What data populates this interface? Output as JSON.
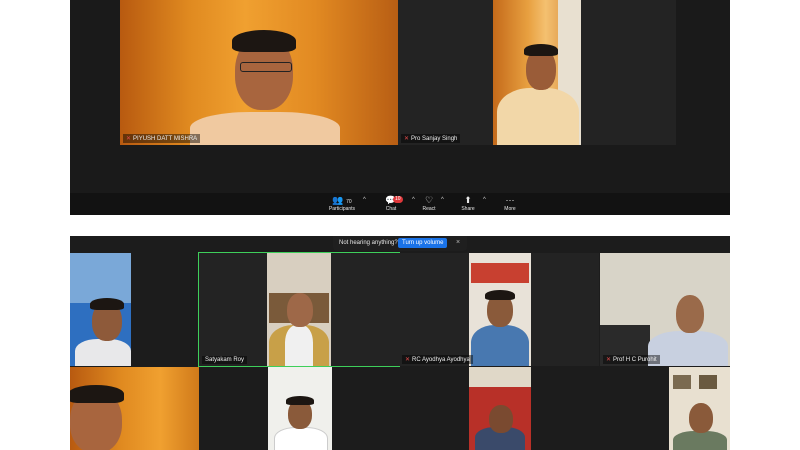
{
  "top": {
    "participants": [
      {
        "name": "PIYUSH DATT MISHRA"
      },
      {
        "name": "Pro Sanjay Singh"
      }
    ],
    "toolbar": {
      "participants_count": "70",
      "participants_label": "Participants",
      "chat_label": "Chat",
      "chat_badge": "10",
      "react_label": "React",
      "share_label": "Share",
      "more_label": "More"
    }
  },
  "bottom": {
    "notice": {
      "text": "Not hearing anything?",
      "button": "Turn up volume",
      "close": "×"
    },
    "participants": [
      {
        "name": "Satyakam Roy"
      },
      {
        "name": "RC Ayodhya Ayodhya"
      },
      {
        "name": "Prof H C Purohit"
      }
    ]
  },
  "colors": {
    "chat_badge": "#e0383b",
    "notice_button": "#1a73e8",
    "active_speaker_border": "#3ecf5a",
    "muted_mic": "#e04a4a"
  }
}
